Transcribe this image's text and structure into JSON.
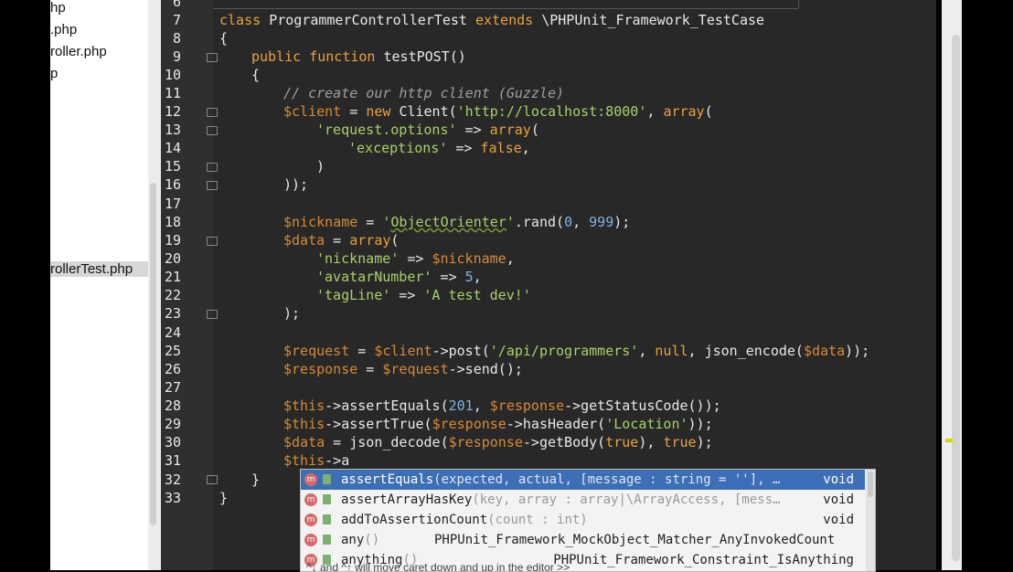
{
  "sidebar": {
    "items": [
      {
        "label": "hp"
      },
      {
        "label": ".php"
      },
      {
        "label": "roller.php"
      },
      {
        "label": "p"
      },
      {
        "label": "rollerTest.php"
      }
    ]
  },
  "editor": {
    "line_numbers": [
      "6",
      "7",
      "8",
      "9",
      "10",
      "11",
      "12",
      "13",
      "14",
      "15",
      "16",
      "17",
      "18",
      "19",
      "20",
      "21",
      "22",
      "23",
      "24",
      "25",
      "26",
      "27",
      "28",
      "29",
      "30",
      "31",
      "32",
      "33"
    ],
    "code": {
      "l7a": "class ",
      "l7b": "ProgrammerControllerTest ",
      "l7c": "extends ",
      "l7d": "\\PHPUnit_Framework_TestCase",
      "l8": "{",
      "l9a": "public function ",
      "l9b": "testPOST()",
      "l10": "{",
      "l11": "// create our http client (Guzzle)",
      "l12a": "$client",
      "l12b": " = ",
      "l12c": "new ",
      "l12d": "Client(",
      "l12e": "'http://localhost:8000'",
      "l12f": ", ",
      "l12g": "array",
      "l12h": "(",
      "l13a": "'request.options'",
      "l13b": " => ",
      "l13c": "array",
      "l13d": "(",
      "l14a": "'exceptions'",
      "l14b": " => ",
      "l14c": "false",
      "l14d": ",",
      "l15": ")",
      "l16": "));",
      "l18a": "$nickname",
      "l18b": " = ",
      "l18c": "'",
      "l18d": "ObjectOrienter",
      "l18e": "'",
      "l18f": ".rand(",
      "l18g": "0",
      "l18h": ", ",
      "l18i": "999",
      "l18j": ");",
      "l19a": "$data",
      "l19b": " = ",
      "l19c": "array",
      "l19d": "(",
      "l20a": "'nickname'",
      "l20b": " => ",
      "l20c": "$nickname",
      "l20d": ",",
      "l21a": "'avatarNumber'",
      "l21b": " => ",
      "l21c": "5",
      "l21d": ",",
      "l22a": "'tagLine'",
      "l22b": " => ",
      "l22c": "'A test dev!'",
      "l23": ");",
      "l25a": "$request",
      "l25b": " = ",
      "l25c": "$client",
      "l25d": "->post(",
      "l25e": "'/api/programmers'",
      "l25f": ", ",
      "l25g": "null",
      "l25h": ", json_encode(",
      "l25i": "$data",
      "l25j": "));",
      "l26a": "$response",
      "l26b": " = ",
      "l26c": "$request",
      "l26d": "->send();",
      "l28a": "$this",
      "l28b": "->assertEquals(",
      "l28c": "201",
      "l28d": ", ",
      "l28e": "$response",
      "l28f": "->getStatusCode());",
      "l29a": "$this",
      "l29b": "->assertTrue(",
      "l29c": "$response",
      "l29d": "->hasHeader(",
      "l29e": "'Location'",
      "l29f": "));",
      "l30a": "$data",
      "l30b": " = json_decode(",
      "l30c": "$response",
      "l30d": "->getBody(",
      "l30e": "true",
      "l30f": "), ",
      "l30g": "true",
      "l30h": ");",
      "l31a": "$this",
      "l31b": "->a",
      "l32": "}",
      "l33": "}"
    }
  },
  "autocomplete": {
    "items": [
      {
        "name": "assertEquals",
        "sig": "(expected, actual, [message : string = ''], …",
        "type": "void"
      },
      {
        "name": "assertArrayHasKey",
        "sig": "(key, array : array|\\ArrayAccess, [mess…",
        "type": "void"
      },
      {
        "name": "addToAssertionCount",
        "sig": "(count : int)",
        "type": "void"
      },
      {
        "name": "any",
        "sig": "()",
        "type": "PHPUnit_Framework_MockObject_Matcher_AnyInvokedCount"
      },
      {
        "name": "anything",
        "sig": "()",
        "type": "PHPUnit_Framework_Constraint_IsAnything"
      }
    ],
    "hint": "^↓ and ^↑ will move caret down and up in the editor  >>"
  },
  "colors": {
    "editor_bg": "#282828",
    "selection": "#3d6fb6",
    "keyword": "#e9a13f",
    "string": "#a9d069",
    "number": "#7fb3e0"
  }
}
